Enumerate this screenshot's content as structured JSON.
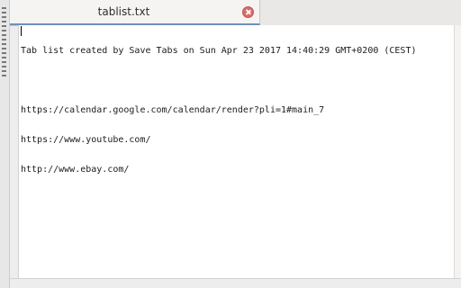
{
  "tab": {
    "title": "tablist.txt",
    "close_icon": "close-icon"
  },
  "editor": {
    "lines": [
      "Tab list created by Save Tabs on Sun Apr 23 2017 14:40:29 GMT+0200 (CEST)",
      "",
      "https://calendar.google.com/calendar/render?pli=1#main_7",
      "https://www.youtube.com/",
      "http://www.ebay.com/"
    ]
  },
  "colors": {
    "close_button": "#d96b6b",
    "active_tab_underline": "#6f8fbf",
    "editor_background": "#ffffff"
  }
}
